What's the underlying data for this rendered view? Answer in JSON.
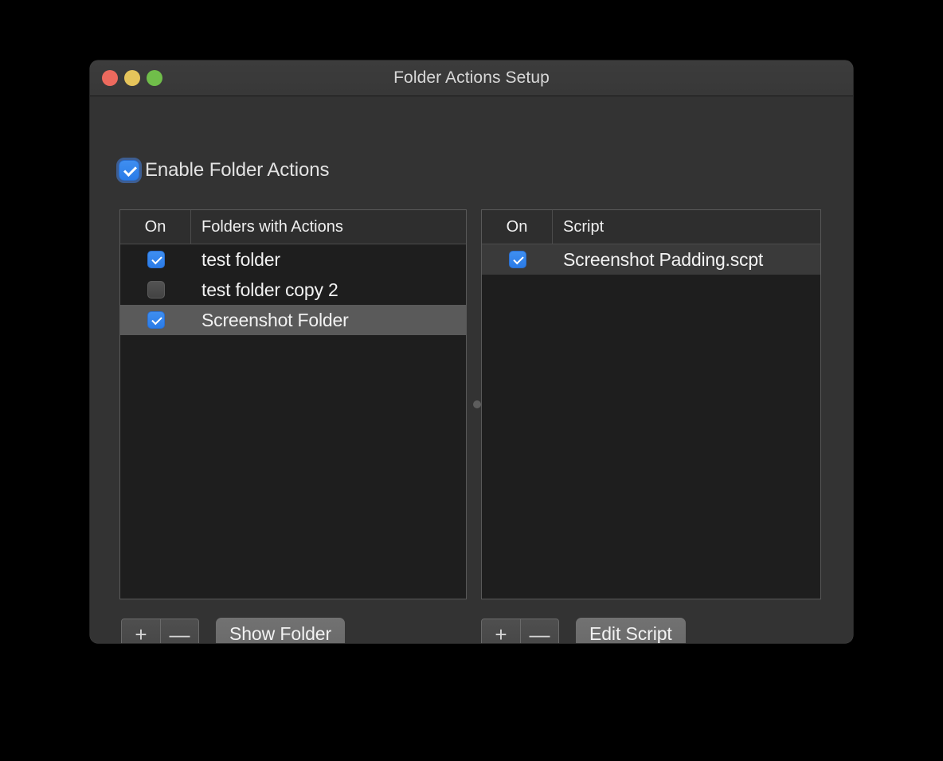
{
  "window": {
    "title": "Folder Actions Setup",
    "traffic_lights": [
      {
        "name": "close",
        "color": "#ed6a5e"
      },
      {
        "name": "minimize",
        "color": "#e5c45b"
      },
      {
        "name": "zoom",
        "color": "#70be4a"
      }
    ]
  },
  "enable": {
    "label": "Enable Folder Actions",
    "checked": true
  },
  "folders_table": {
    "headers": {
      "on": "On",
      "name": "Folders with Actions"
    },
    "rows": [
      {
        "checked": true,
        "name": "test folder",
        "state": "normal"
      },
      {
        "checked": false,
        "name": "test folder copy 2",
        "state": "normal"
      },
      {
        "checked": true,
        "name": "Screenshot Folder",
        "state": "selected"
      }
    ]
  },
  "scripts_table": {
    "headers": {
      "on": "On",
      "name": "Script"
    },
    "rows": [
      {
        "checked": true,
        "name": "Screenshot Padding.scpt",
        "state": "alt"
      }
    ]
  },
  "left_buttons": {
    "add": "+",
    "remove": "—",
    "action": "Show Folder"
  },
  "right_buttons": {
    "add": "+",
    "remove": "—",
    "action": "Edit Script"
  },
  "colors": {
    "accent_checkbox": "#2f84ea",
    "window_bg": "#333333",
    "table_bg": "#1e1e1e",
    "selection": "#5a5a5a"
  }
}
